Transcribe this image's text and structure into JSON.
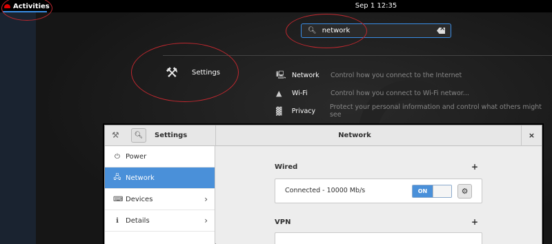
{
  "topbar": {
    "activities_label": "Activities",
    "clock": "Sep 1  12:35"
  },
  "search": {
    "value": "network"
  },
  "app_result": {
    "label": "Settings",
    "icon": "tools-icon"
  },
  "results": [
    {
      "name": "Network",
      "desc": "Control how you connect to the Internet",
      "icon": "network-icon"
    },
    {
      "name": "Wi-Fi",
      "desc": "Control how you connect to Wi-Fi networ...",
      "icon": "wifi-icon"
    },
    {
      "name": "Privacy",
      "desc": "Protect your personal information and control what others might see",
      "icon": "privacy-icon"
    }
  ],
  "window": {
    "left_title": "Settings",
    "center_title": "Network",
    "close_label": "×",
    "search_icon": "search-icon"
  },
  "sidebar": {
    "items": [
      {
        "label": "Power",
        "icon": "power-icon",
        "glyph": "⏻"
      },
      {
        "label": "Network",
        "icon": "network-icon",
        "glyph": "🖧"
      },
      {
        "label": "Devices",
        "icon": "devices-icon",
        "glyph": "⌨"
      },
      {
        "label": "Details",
        "icon": "details-icon",
        "glyph": "ℹ"
      }
    ]
  },
  "content": {
    "wired": {
      "title": "Wired",
      "add_label": "+",
      "connection_text": "Connected - 10000 Mb/s",
      "toggle_label": "ON",
      "toggle_state": "on"
    },
    "vpn": {
      "title": "VPN",
      "add_label": "+"
    }
  },
  "colors": {
    "accent": "#4a90d9",
    "annotation": "#c0282f",
    "search_focus": "#3a8ee6"
  }
}
